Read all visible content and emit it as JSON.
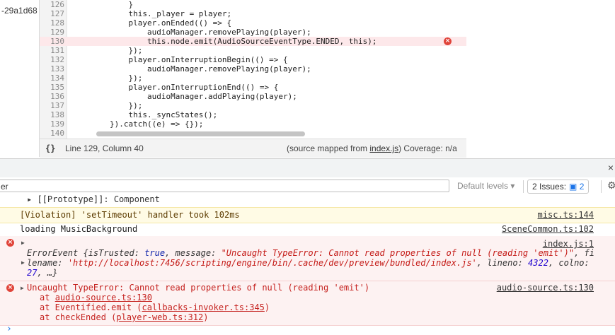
{
  "sidebar": {
    "hash_fragment": "-29a1d68"
  },
  "editor": {
    "lines": [
      {
        "num": "126",
        "code": "            }"
      },
      {
        "num": "127",
        "code": "            this._player = player;"
      },
      {
        "num": "128",
        "code": "            player.onEnded(() => {"
      },
      {
        "num": "129",
        "code": "                audioManager.removePlaying(player);"
      },
      {
        "num": "130",
        "code": "                this.node.emit(AudioSourceEventType.ENDED, this);"
      },
      {
        "num": "131",
        "code": "            });"
      },
      {
        "num": "132",
        "code": "            player.onInterruptionBegin(() => {"
      },
      {
        "num": "133",
        "code": "                audioManager.removePlaying(player);"
      },
      {
        "num": "134",
        "code": "            });"
      },
      {
        "num": "135",
        "code": "            player.onInterruptionEnd(() => {"
      },
      {
        "num": "136",
        "code": "                audioManager.addPlaying(player);"
      },
      {
        "num": "137",
        "code": "            });"
      },
      {
        "num": "138",
        "code": "            this._syncStates();"
      },
      {
        "num": "139",
        "code": "        }).catch((e) => {});"
      },
      {
        "num": "140",
        "code": ""
      }
    ],
    "error_mark": "×",
    "status": {
      "braces": "{}",
      "position": "Line 129, Column 40",
      "mapped_prefix": "(source mapped from ",
      "mapped_file": "index.js",
      "mapped_suffix": ") Coverage: n/a"
    }
  },
  "drawer": {
    "close": "×"
  },
  "filter": {
    "value": "er",
    "levels_label": "Default levels ▾",
    "issues_label": "2 Issues:",
    "issues_count": "2",
    "issues_icon": "message-icon",
    "gear_icon": "⚙"
  },
  "console": {
    "proto": "▸ [[Prototype]]: Component",
    "warn": {
      "text": "[Violation] 'setTimeout' handler took 102ms",
      "source": "misc.ts:144"
    },
    "info": {
      "text": "loading MusicBackground",
      "source": "SceneCommon.ts:102"
    },
    "err1": {
      "source": "index.js:1",
      "line1_prefix": "ErrorEvent {",
      "line1_k1": "isTrusted",
      "line1_v1": "true",
      "line1_k2": "message",
      "line1_v2": "\"Uncaught TypeError: Cannot read properties of null (reading 'emit')\"",
      "line1_k3": "fi",
      "line2_k": "lename",
      "line2_v": "'http://localhost:7456/scripting/engine/bin/.cache/dev/preview/bundled/index.js'",
      "line2_k2": "lineno",
      "line2_v2": "4322",
      "line2_k3": "colno",
      "line3_v": "27",
      "line3_rest": ", …}"
    },
    "err2": {
      "message": "Uncaught TypeError: Cannot read properties of null (reading 'emit')",
      "source": "audio-source.ts:130",
      "stack1_prefix": "at ",
      "stack1_link": "audio-source.ts:130",
      "stack2_prefix": "at Eventified.emit (",
      "stack2_link": "callbacks-invoker.ts:345",
      "stack3_prefix": "at checkEnded (",
      "stack3_link": "player-web.ts:312",
      "close_paren": ")"
    },
    "prompt": "›"
  }
}
